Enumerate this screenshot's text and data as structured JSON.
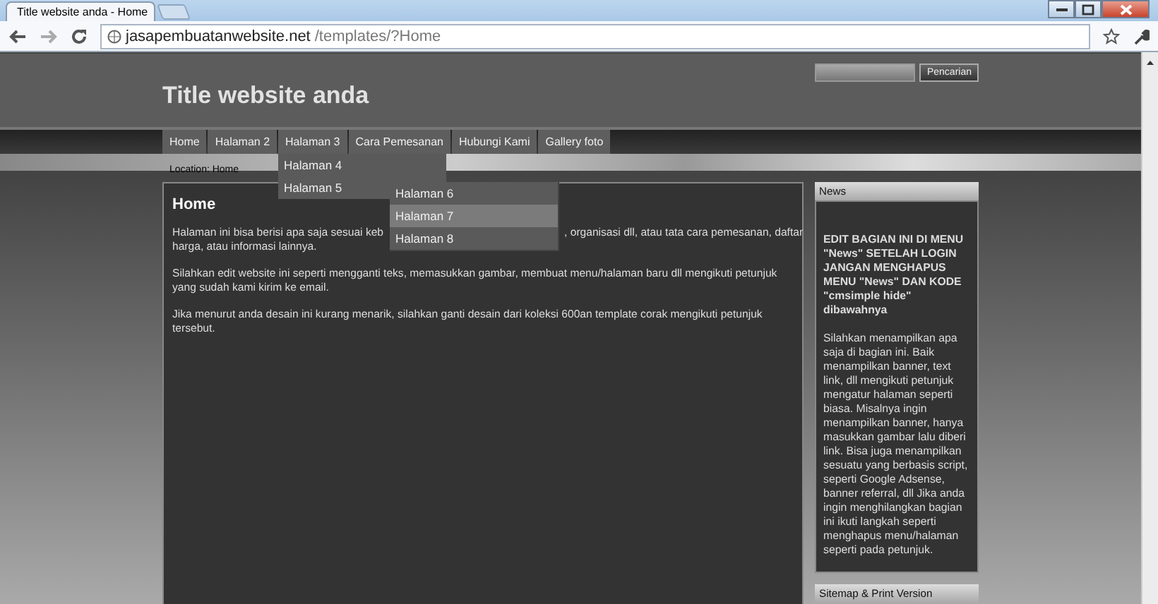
{
  "browser": {
    "tabs": [
      {
        "title": "Title website anda - Home",
        "selected": true
      }
    ],
    "url": {
      "host": "jasapembuatanwebsite.net",
      "path": "/templates/?Home"
    }
  },
  "site": {
    "title": "Title website anda",
    "search": {
      "button": "Pencarian"
    },
    "nav": [
      {
        "label": "Home"
      },
      {
        "label": "Halaman 2"
      },
      {
        "label": "Halaman 3",
        "children": [
          {
            "label": "Halaman 4",
            "selected": false
          },
          {
            "label": "Halaman 5",
            "selected": false,
            "children": [
              {
                "label": "Halaman 6",
                "selected": false
              },
              {
                "label": "Halaman 7",
                "selected": true
              },
              {
                "label": "Halaman 8",
                "selected": false
              }
            ]
          }
        ]
      },
      {
        "label": "Cara Pemesanan"
      },
      {
        "label": "Hubungi Kami"
      },
      {
        "label": "Gallery foto"
      }
    ],
    "location": "Location: Home",
    "content": {
      "heading": "Home",
      "paragraphs": [
        {
          "kind": "covered",
          "lines": [
            [
              "Halaman ini bisa berisi apa saja sesuai keb",
              ", organisasi dll, atau tata cara pemesanan, daftar"
            ],
            [
              "harga, atau informasi lainnya."
            ]
          ]
        },
        {
          "parts": [
            "Silahkan edit website ini seperti mengganti teks, memasukkan gambar, membuat menu/halaman baru dll mengikuti petunjuk yang sudah kami kirim ke email."
          ]
        },
        {
          "parts": [
            "Jika menurut anda desain ini kurang menarik, silahkan ganti desain dari koleksi 600an template corak mengikuti petunjuk tersebut."
          ]
        }
      ]
    },
    "sidebar": [
      {
        "title": "News",
        "heading": "EDIT BAGIAN INI DI MENU \"News\" SETELAH LOGIN JANGAN MENGHAPUS MENU \"News\" DAN KODE \"cmsimple hide\" dibawahnya",
        "body": "Silahkan menampilkan apa saja di bagian ini. Baik menampilkan banner, text link, dll mengikuti petunjuk mengatur halaman seperti biasa. Misalnya ingin menampilkan banner, hanya masukkan gambar lalu diberi link. Bisa juga menampilkan sesuatu yang berbasis script, seperti Google Adsense, banner referral, dll Jika anda ingin menghilangkan bagian ini ikuti langkah seperti menghapus menu/halaman seperti pada petunjuk."
      },
      {
        "title": "Sitemap & Print Version"
      }
    ]
  }
}
